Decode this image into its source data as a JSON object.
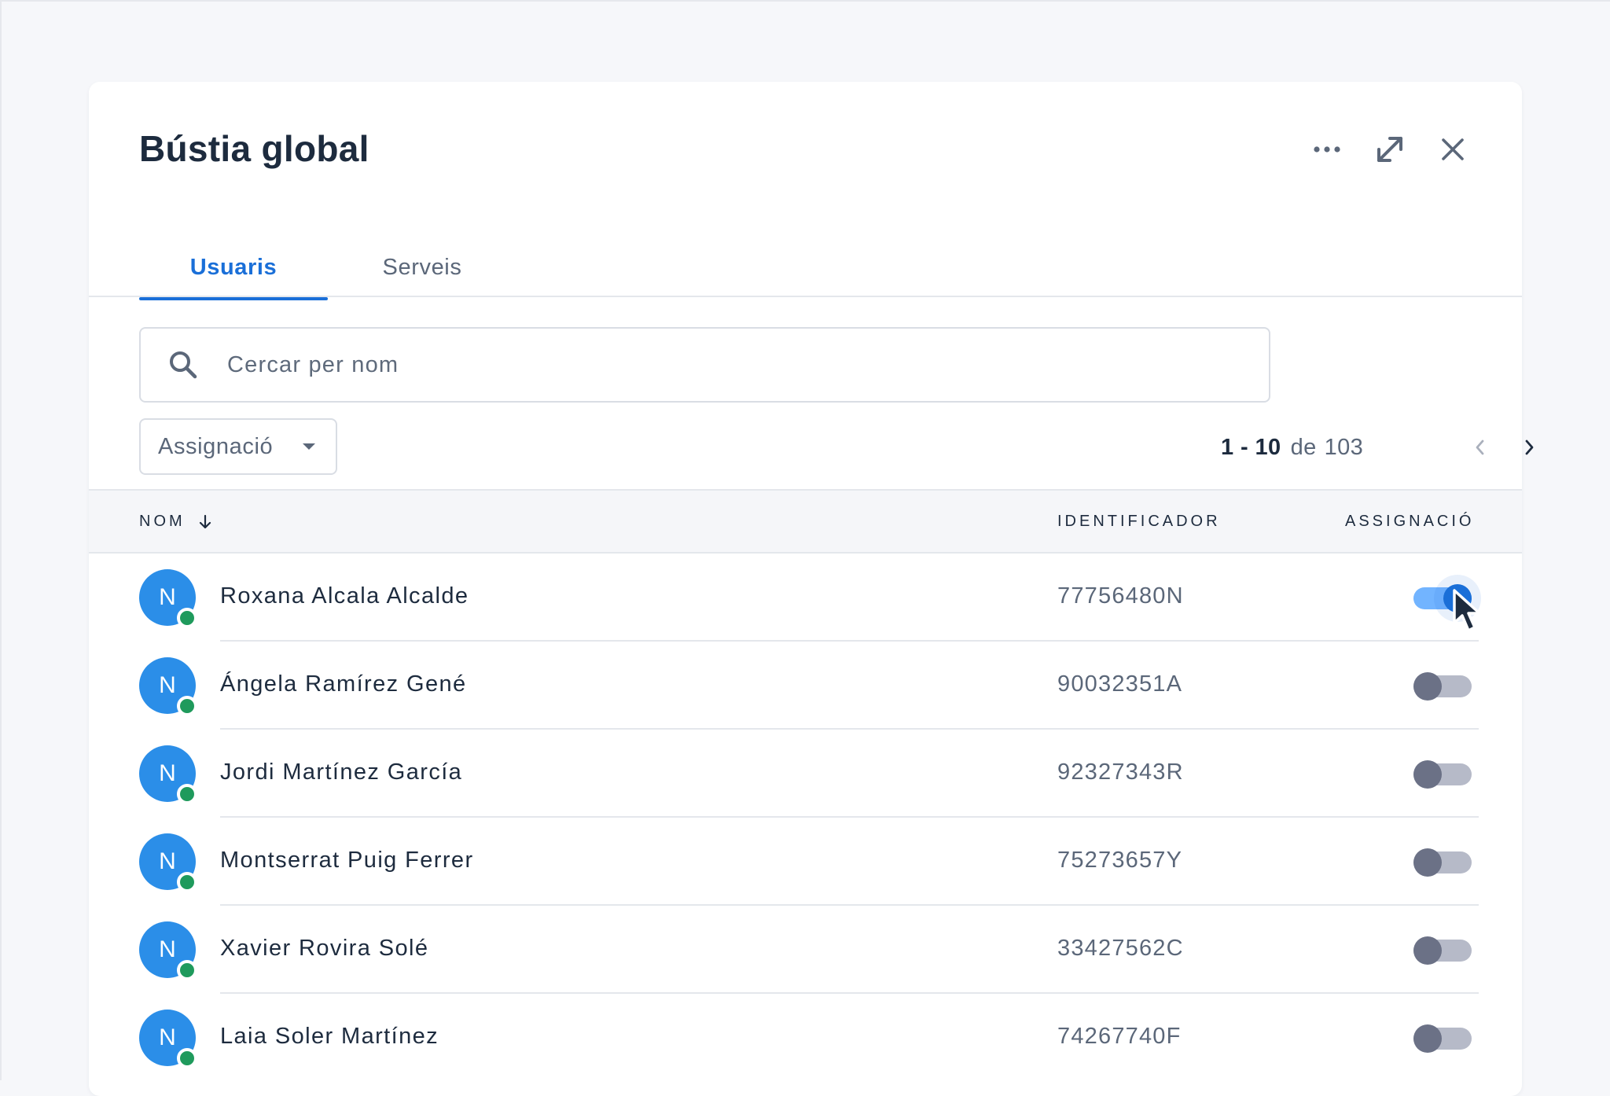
{
  "dialog": {
    "title": "Bústia global",
    "more_icon": "more-horizontal-icon",
    "expand_icon": "expand-icon",
    "close_icon": "close-icon"
  },
  "tabs": [
    {
      "label": "Usuaris",
      "active": true
    },
    {
      "label": "Serveis",
      "active": false
    }
  ],
  "search": {
    "placeholder": "Cercar per nom",
    "value": "",
    "icon": "search-icon"
  },
  "filter": {
    "label": "Assignació",
    "icon": "caret-down-icon"
  },
  "pagination": {
    "range": "1 - 10",
    "of": "de",
    "total": "103",
    "prev_icon": "chevron-left-icon",
    "next_icon": "chevron-right-icon"
  },
  "table": {
    "headers": {
      "name": "NOM",
      "id": "IDENTIFICADOR",
      "assignment": "ASSIGNACIÓ"
    },
    "sort_icon": "arrow-down-icon",
    "rows": [
      {
        "initial": "N",
        "name": "Roxana Alcala Alcalde",
        "id": "77756480N",
        "assigned": true
      },
      {
        "initial": "N",
        "name": "Ángela Ramírez Gené",
        "id": "90032351A",
        "assigned": false
      },
      {
        "initial": "N",
        "name": "Jordi Martínez García",
        "id": "92327343R",
        "assigned": false
      },
      {
        "initial": "N",
        "name": "Montserrat Puig Ferrer",
        "id": "75273657Y",
        "assigned": false
      },
      {
        "initial": "N",
        "name": "Xavier Rovira Solé",
        "id": "33427562C",
        "assigned": false
      },
      {
        "initial": "N",
        "name": "Laia Soler Martínez",
        "id": "74267740F",
        "assigned": false
      }
    ]
  },
  "colors": {
    "accent": "#1a6fd8",
    "avatar": "#2b8ee8",
    "online": "#1f9a5c",
    "toggle_off": "#6b7186"
  }
}
